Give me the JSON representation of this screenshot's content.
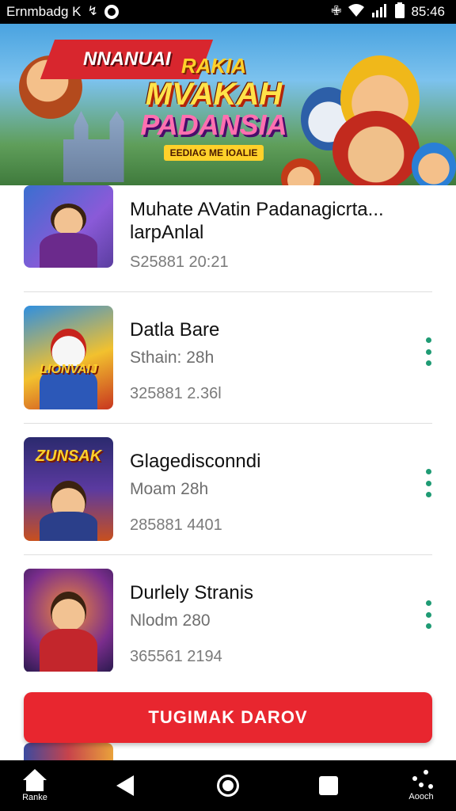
{
  "status_bar": {
    "app_name": "Ernmbadg K",
    "time": "85:46"
  },
  "banner": {
    "sash_text": "NNANUAI",
    "title_line1": "RAKIA",
    "title_line2": "MVAKAH",
    "title_line3": "PADANSIA",
    "title_line4": "EEDIAG ME IOALIE"
  },
  "list": {
    "items": [
      {
        "title": "Muhate AVatin Padanagicrta... larpAnlal",
        "subtitle": "",
        "meta": "S25881 20:21",
        "thumb_label": "",
        "has_more": false
      },
      {
        "title": "Datla Bare",
        "subtitle": "Sthain: 28h",
        "meta": "325881 2.36l",
        "thumb_label": "LIONVAIJ",
        "has_more": true
      },
      {
        "title": "Glagedisconndi",
        "subtitle": "Moam 28h",
        "meta": "285881 4401",
        "thumb_label": "ZUNSAK",
        "has_more": true
      },
      {
        "title": "Durlely Stranis",
        "subtitle": "Nlodm 280",
        "meta": "365561 2194",
        "thumb_label": "",
        "has_more": true
      }
    ]
  },
  "cta": {
    "label": "TUGIMAK DAROV"
  },
  "nav_bar": {
    "home_label": "Ranke",
    "assist_label": "Aooch"
  },
  "colors": {
    "accent_red": "#e8262f",
    "more_icon_green": "#1f9b74",
    "status_bar_bg": "#000000"
  }
}
